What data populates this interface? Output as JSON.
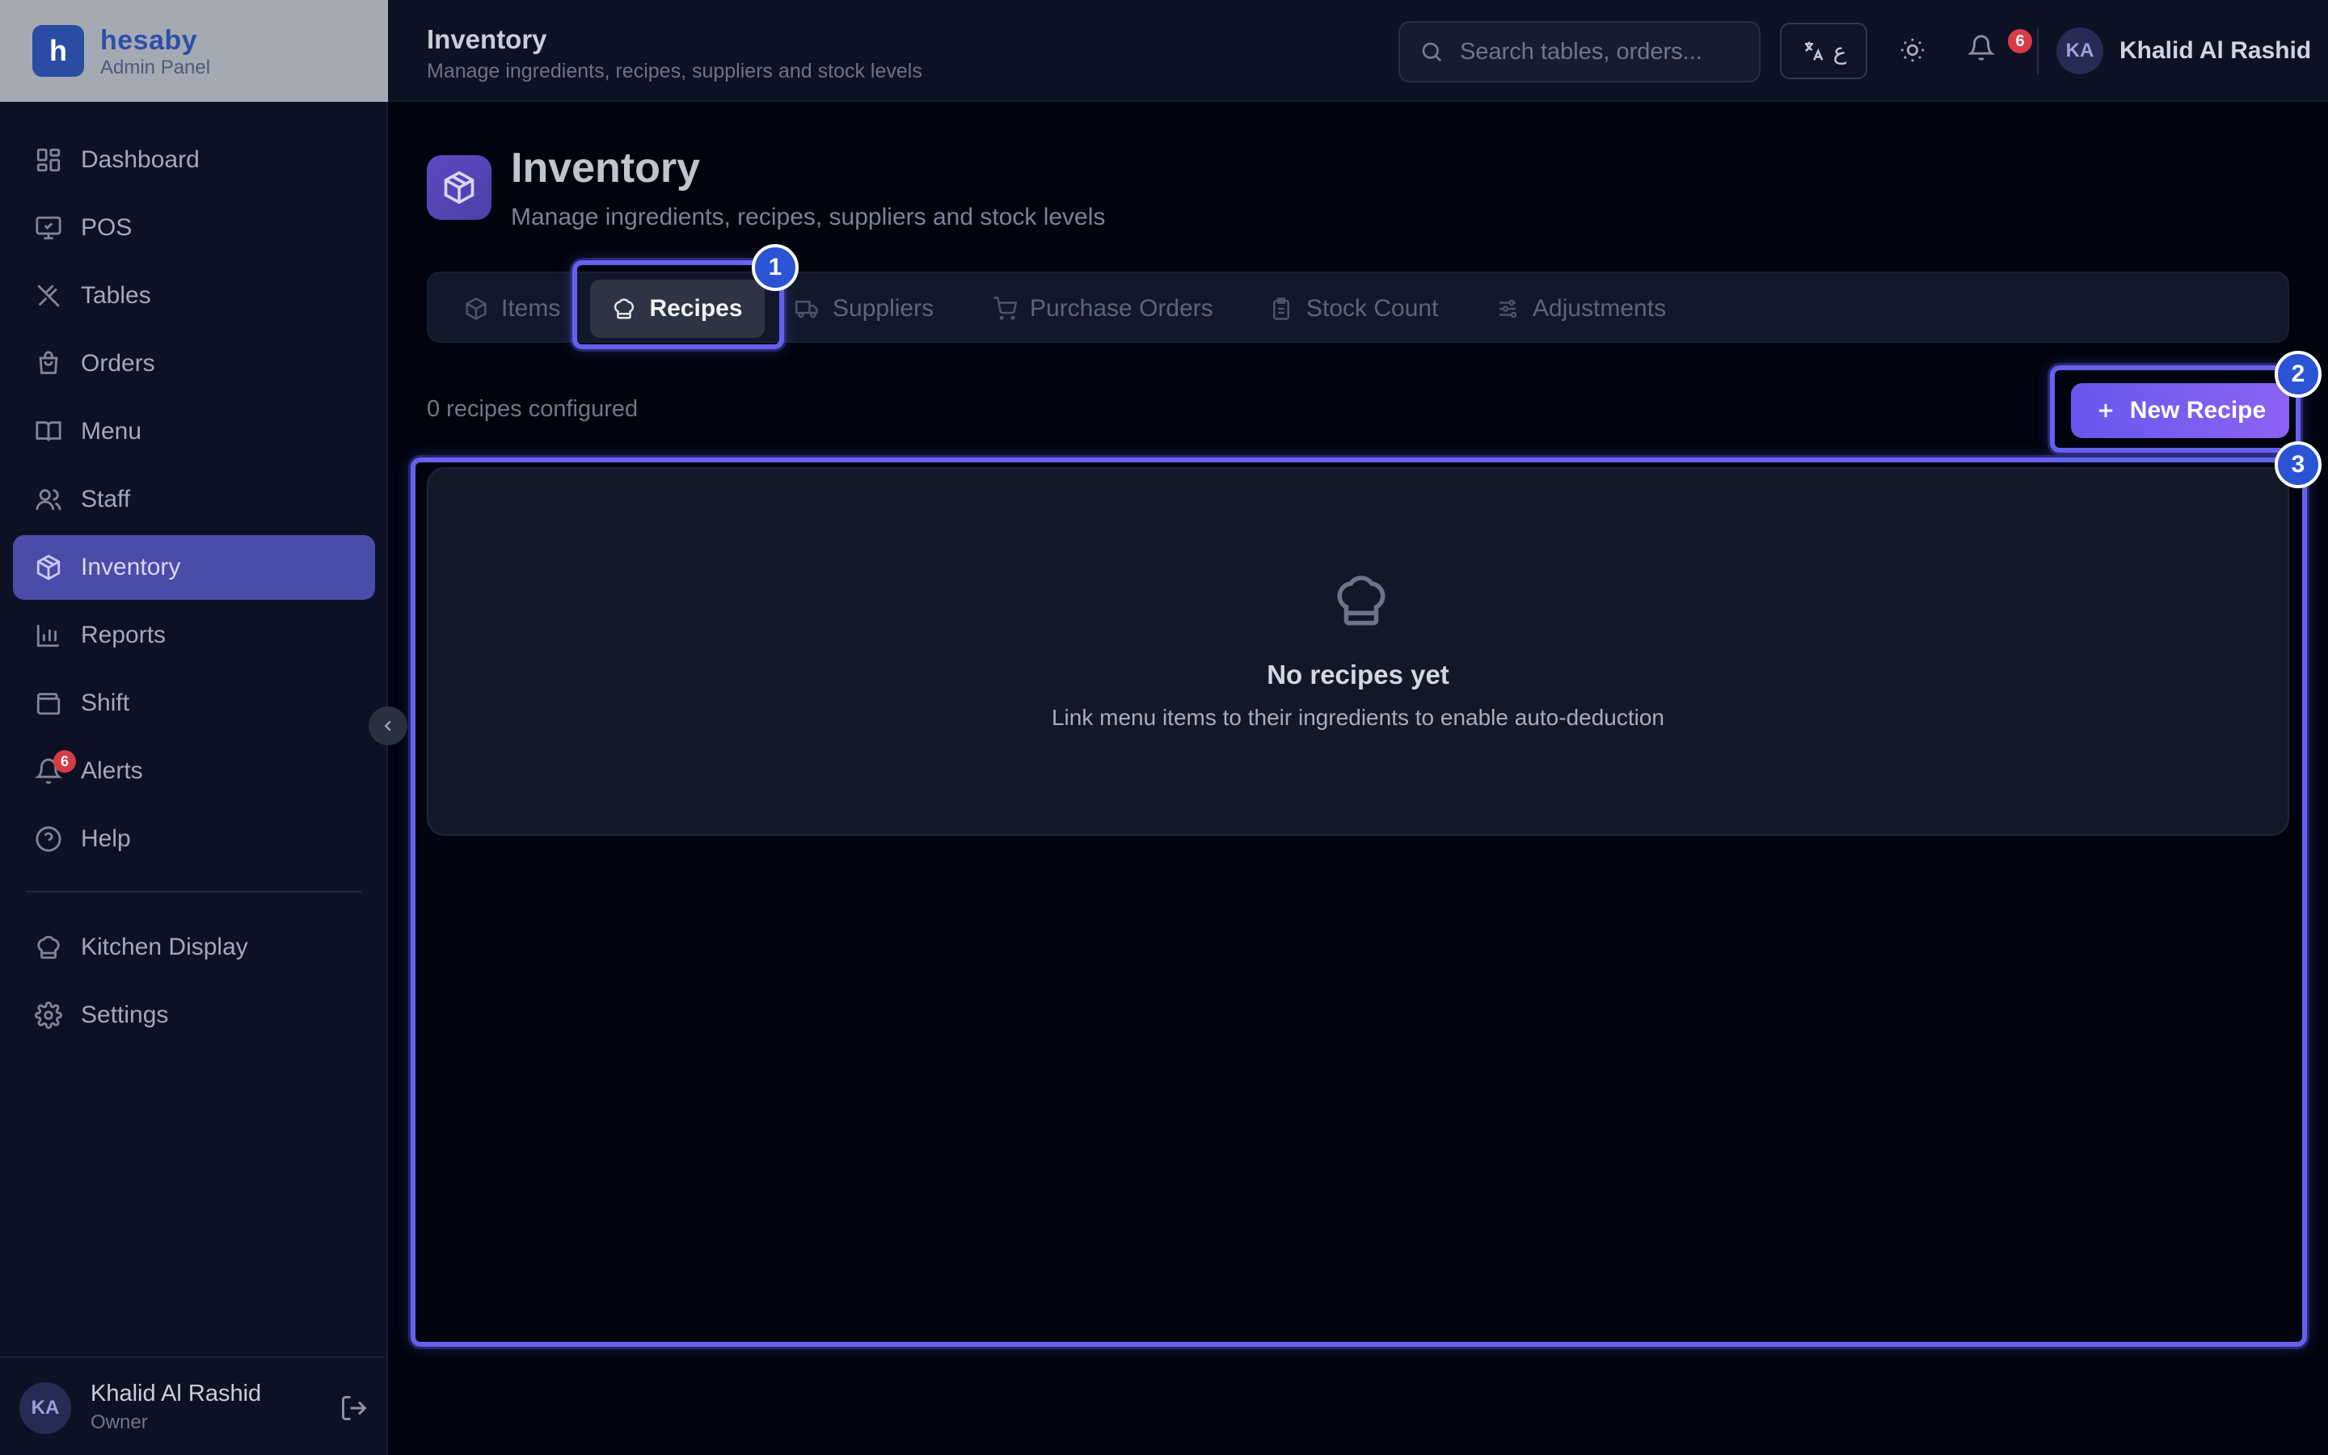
{
  "brand": {
    "logo_letter": "h",
    "name": "hesaby",
    "subtitle": "Admin Panel"
  },
  "sidebar": {
    "items": [
      {
        "label": "Dashboard",
        "icon": "dashboard-icon"
      },
      {
        "label": "POS",
        "icon": "monitor-icon"
      },
      {
        "label": "Tables",
        "icon": "utensils-icon"
      },
      {
        "label": "Orders",
        "icon": "bag-icon"
      },
      {
        "label": "Menu",
        "icon": "book-icon"
      },
      {
        "label": "Staff",
        "icon": "users-icon"
      },
      {
        "label": "Inventory",
        "icon": "box-icon",
        "active": true
      },
      {
        "label": "Reports",
        "icon": "bar-chart-icon"
      },
      {
        "label": "Shift",
        "icon": "wallet-icon"
      },
      {
        "label": "Alerts",
        "icon": "bell-icon",
        "badge": "6"
      },
      {
        "label": "Help",
        "icon": "help-circle-icon"
      }
    ],
    "secondary": [
      {
        "label": "Kitchen Display",
        "icon": "chef-hat-icon"
      },
      {
        "label": "Settings",
        "icon": "gear-icon"
      }
    ],
    "user": {
      "initials": "KA",
      "name": "Khalid Al Rashid",
      "role": "Owner"
    }
  },
  "header": {
    "title": "Inventory",
    "subtitle": "Manage ingredients, recipes, suppliers and stock levels",
    "search_placeholder": "Search tables, orders...",
    "lang_label": "ع",
    "notifications_count": "6",
    "user_initials": "KA",
    "user_name": "Khalid Al Rashid"
  },
  "page": {
    "title": "Inventory",
    "subtitle": "Manage ingredients, recipes, suppliers and stock levels",
    "tabs": [
      {
        "label": "Items"
      },
      {
        "label": "Recipes",
        "active": true
      },
      {
        "label": "Suppliers"
      },
      {
        "label": "Purchase Orders"
      },
      {
        "label": "Stock Count"
      },
      {
        "label": "Adjustments"
      }
    ],
    "count_text": "0 recipes configured",
    "new_button": "New Recipe",
    "empty": {
      "title": "No recipes yet",
      "description": "Link menu items to their ingredients to enable auto-deduction"
    }
  },
  "highlights": [
    "1",
    "2",
    "3"
  ],
  "colors": {
    "accent": "#6461f0",
    "active_nav": "#4a4ca8",
    "badge": "#d93b45"
  }
}
